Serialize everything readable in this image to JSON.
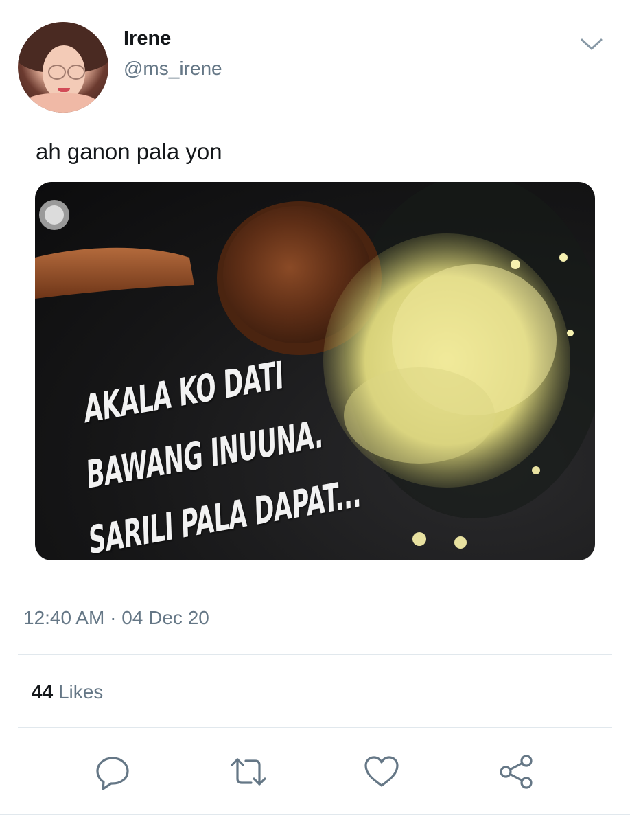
{
  "tweet": {
    "author": {
      "name": "Irene",
      "handle": "@ms_irene"
    },
    "text": "ah ganon pala yon",
    "media": {
      "overlay_lines": [
        "AKALA KO DATI",
        "BAWANG INUUNA.",
        "SARILI PALA DAPAT..."
      ]
    },
    "time": "12:40 AM",
    "separator": "·",
    "date": "04 Dec 20",
    "likes": {
      "count": "44",
      "label": "Likes"
    },
    "actions": [
      {
        "icon": "reply-icon"
      },
      {
        "icon": "retweet-icon"
      },
      {
        "icon": "like-icon"
      },
      {
        "icon": "share-icon"
      }
    ],
    "colors": {
      "text_primary": "#14171a",
      "text_secondary": "#657786",
      "divider": "#e1e8ed",
      "icon": "#657786"
    }
  }
}
